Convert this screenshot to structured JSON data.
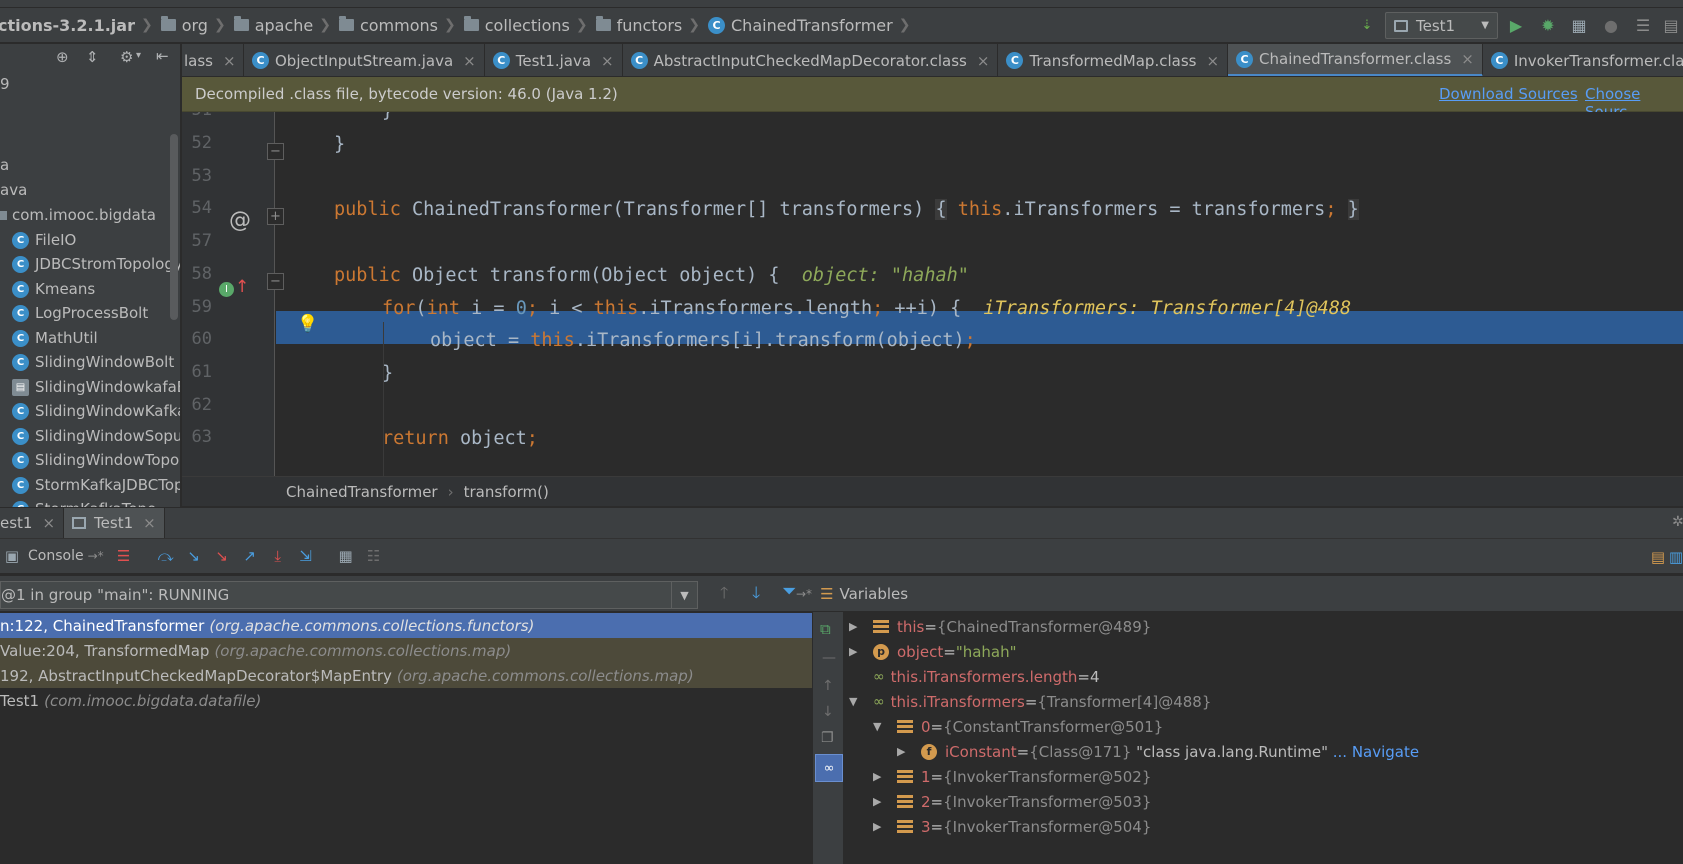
{
  "navbar": {
    "breadcrumbs": [
      "ctions-3.2.1.jar",
      "org",
      "apache",
      "commons",
      "collections",
      "functors",
      "ChainedTransformer"
    ],
    "run_config": "Test1"
  },
  "project": {
    "items": [
      "9",
      "",
      "a",
      "ava",
      "com.imooc.bigdata",
      "FileIO",
      "JDBCStromTopology",
      "Kmeans",
      "LogProcessBolt",
      "MathUtil",
      "SlidingWindowBolt",
      "SlidingWindowkafaB",
      "SlidingWindowKafka",
      "SlidingWindowSopu",
      "SlidingWindowTopo",
      "StormKafkaJDBCTop",
      "StormKafkaTopo"
    ]
  },
  "tabs": [
    {
      "label": "lass",
      "active": false
    },
    {
      "label": "ObjectInputStream.java",
      "active": false
    },
    {
      "label": "Test1.java",
      "active": false
    },
    {
      "label": "AbstractInputCheckedMapDecorator.class",
      "active": false
    },
    {
      "label": "TransformedMap.class",
      "active": false
    },
    {
      "label": "ChainedTransformer.class",
      "active": true
    },
    {
      "label": "InvokerTransformer.class",
      "active": false
    }
  ],
  "banner": {
    "text": "Decompiled .class file, bytecode version: 46.0 (Java 1.2)",
    "download_sources": "Download Sources",
    "choose_sources": "Choose Sourc"
  },
  "editor": {
    "lines": {
      "51": "51",
      "52": "52",
      "53": "53",
      "54": "54",
      "57": "57",
      "58": "58",
      "59": "59",
      "60": "60",
      "61": "61",
      "62": "62",
      "63": "63"
    },
    "code": {
      "l51": "}",
      "l52": "}",
      "l54_kw": "public",
      "l54_a": " ChainedTransformer(Transformer[] transformers) ",
      "l54_b": "{",
      "l54_this": "this",
      "l54_c": ".iTransformers = transformers",
      "l54_semi": ";",
      "l54_d": "}",
      "l58_kw": "public",
      "l58_a": " Object transform(Object object) {  ",
      "l58_hint": "object: \"hahah\"",
      "l59_for": "for",
      "l59_a": "(",
      "l59_int": "int",
      "l59_b": " i = ",
      "l59_zero": "0",
      "l59_semi1": ";",
      "l59_c": " i < ",
      "l59_this": "this",
      "l59_d": ".iTransformers.length",
      "l59_semi2": ";",
      "l59_e": " ++i) {  ",
      "l59_hint": "iTransformers: Transformer[4]@488",
      "l60_a": "object = ",
      "l60_this": "this",
      "l60_b": ".iTransformers[i].transform(object)",
      "l60_semi": ";",
      "l61": "}",
      "l63_kw": "return",
      "l63_a": " object",
      "l63_semi": ";"
    },
    "breadcrumb": [
      "ChainedTransformer",
      "transform()"
    ]
  },
  "debug": {
    "tabs": [
      "est1",
      "Test1"
    ],
    "console_label": "Console",
    "thread": "@1 in group \"main\": RUNNING",
    "frames": [
      {
        "method": "n:122, ChainedTransformer",
        "pkg": "(org.apache.commons.collections.functors)",
        "state": "selected"
      },
      {
        "method": "Value:204, TransformedMap",
        "pkg": "(org.apache.commons.collections.map)",
        "state": "lib"
      },
      {
        "method": "192, AbstractInputCheckedMapDecorator$MapEntry",
        "pkg": "(org.apache.commons.collections.map)",
        "state": "lib"
      },
      {
        "method": "Test1",
        "pkg": "(com.imooc.bigdata.datafile)",
        "state": "normal"
      }
    ],
    "variables_title": "Variables",
    "variables": [
      {
        "name": "this",
        "value": "{ChainedTransformer@489}"
      },
      {
        "name": "object",
        "value": "\"hahah\""
      },
      {
        "name": "this.iTransformers.length",
        "value": "4"
      },
      {
        "name": "this.iTransformers",
        "value": "{Transformer[4]@488}"
      },
      {
        "name": "0",
        "value": "{ConstantTransformer@501}"
      },
      {
        "name": "iConstant",
        "value": "{Class@171}",
        "extra": "\"class java.lang.Runtime\"",
        "nav": "... Navigate"
      },
      {
        "name": "1",
        "value": "{InvokerTransformer@502}"
      },
      {
        "name": "2",
        "value": "{InvokerTransformer@503}"
      },
      {
        "name": "3",
        "value": "{InvokerTransformer@504}"
      }
    ],
    "equals": " = "
  }
}
